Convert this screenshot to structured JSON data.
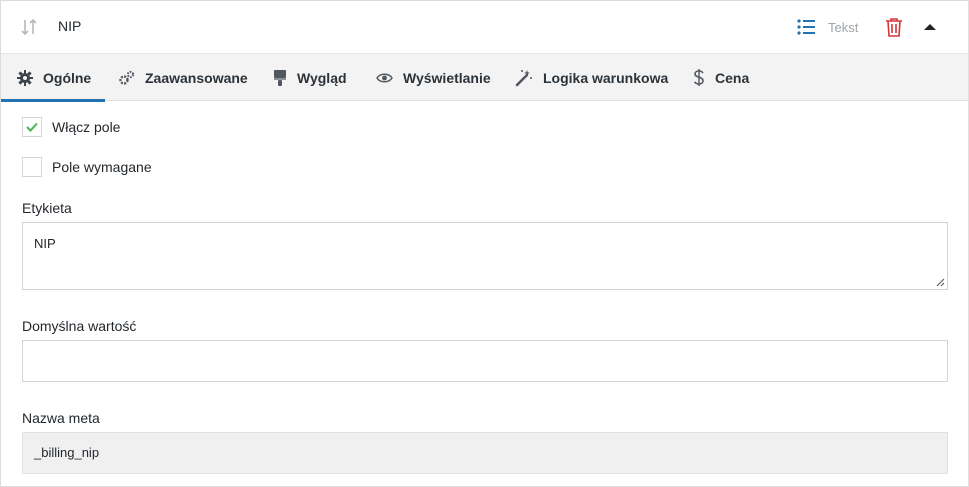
{
  "header": {
    "field_title": "NIP",
    "field_type": "Tekst",
    "icons": {
      "sort": "sort-arrows-icon",
      "type": "list-icon",
      "delete": "trash-icon",
      "toggle": "caret-up-icon"
    }
  },
  "tabs": [
    {
      "label": "Ogólne",
      "icon": "gear-icon",
      "active": true
    },
    {
      "label": "Zaawansowane",
      "icon": "gears-icon",
      "active": false
    },
    {
      "label": "Wygląd",
      "icon": "paint-brush-icon",
      "active": false
    },
    {
      "label": "Wyświetlanie",
      "icon": "eye-icon",
      "active": false
    },
    {
      "label": "Logika warunkowa",
      "icon": "magic-wand-icon",
      "active": false
    },
    {
      "label": "Cena",
      "icon": "dollar-icon",
      "active": false
    }
  ],
  "form": {
    "enable_field": {
      "label": "Włącz pole",
      "checked": true
    },
    "required": {
      "label": "Pole wymagane",
      "checked": false
    },
    "label_field": {
      "label": "Etykieta",
      "value": "NIP"
    },
    "default_value": {
      "label": "Domyślna wartość",
      "value": ""
    },
    "meta_name": {
      "label": "Nazwa meta",
      "value": "_billing_nip"
    }
  },
  "colors": {
    "accent": "#2271b1",
    "check": "#46b450",
    "delete": "#d63638",
    "tab_bg": "#f3f3f4"
  }
}
